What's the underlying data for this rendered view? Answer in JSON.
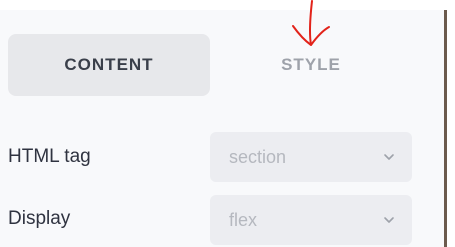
{
  "tabs": {
    "content_label": "CONTENT",
    "style_label": "STYLE"
  },
  "fields": {
    "html_tag": {
      "label": "HTML tag",
      "value": "section"
    },
    "display": {
      "label": "Display",
      "value": "flex"
    }
  },
  "colors": {
    "active_tab_bg": "#e7e8eb",
    "annotation": "#e2231a"
  }
}
